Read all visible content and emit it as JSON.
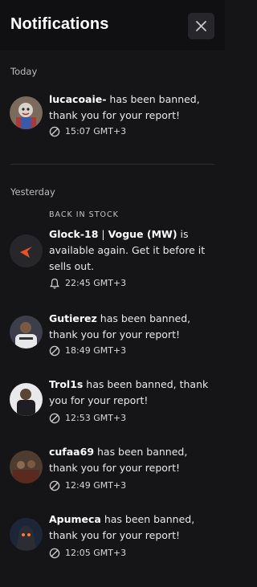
{
  "header": {
    "title": "Notifications",
    "close_icon": "close-icon"
  },
  "sections": {
    "today": "Today",
    "yesterday": "Yesterday"
  },
  "notifications": [
    {
      "user": "lucacoaie-",
      "text": " has been banned, thank you for your report!",
      "time": "15:07 GMT+3",
      "icon": "ban-icon"
    },
    {
      "tag": "BACK IN STOCK",
      "item": "Glock-18",
      "sep": " | ",
      "skin": "Vogue (MW)",
      "text": " is available again. Get it before it sells out.",
      "time": "22:45 GMT+3",
      "icon": "bell-icon"
    },
    {
      "user": "Gutierez",
      "text": " has been banned, thank you for your report!",
      "time": "18:49 GMT+3",
      "icon": "ban-icon"
    },
    {
      "user": "Trol1s",
      "text": " has been banned, thank you for your report!",
      "time": "12:53 GMT+3",
      "icon": "ban-icon"
    },
    {
      "user": "cufaa69",
      "text": " has been banned, thank you for your report!",
      "time": "12:49 GMT+3",
      "icon": "ban-icon"
    },
    {
      "user": "Apumeca",
      "text": " has been banned, thank you for your report!",
      "time": "12:05 GMT+3",
      "icon": "ban-icon"
    }
  ],
  "colors": {
    "background": "#151518",
    "header": "#101013",
    "accent": "#e8542a"
  }
}
